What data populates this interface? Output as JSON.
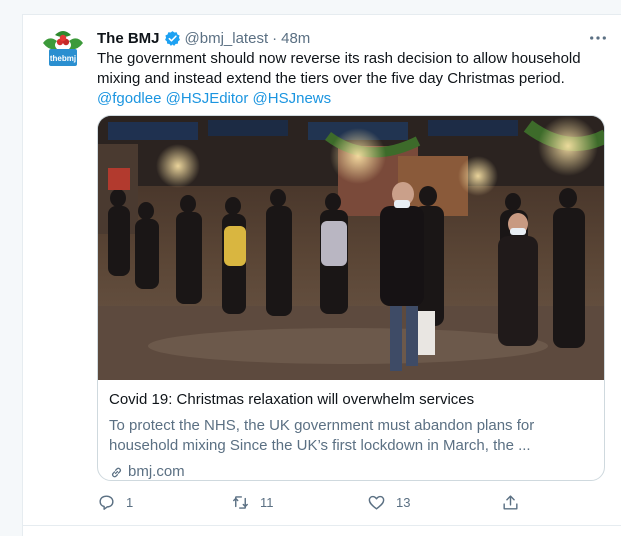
{
  "tweet": {
    "author": {
      "name": "The BMJ",
      "handle": "@bmj_latest",
      "avatar_text": "thebmj",
      "verified": true
    },
    "separator": "·",
    "time": "48m",
    "text": "The government should now reverse its rash decision to allow household mixing and instead extend the tiers over the five day Christmas period.",
    "mentions": [
      "@fgodlee",
      "@HSJEditor",
      "@HSJnews"
    ],
    "card": {
      "title": "Covid 19: Christmas relaxation will overwhelm services",
      "description": "To protect the NHS, the UK government must abandon plans for household mixing Since the UK’s first lockdown in March, the ...",
      "domain": "bmj.com",
      "image_alt": "Crowd of shoppers wearing face masks on a festive London street"
    },
    "actions": {
      "replies": "1",
      "retweets": "11",
      "likes": "13"
    }
  },
  "colors": {
    "link": "#1b95e0",
    "muted": "#5b7083",
    "verified": "#1da1f2",
    "border": "#cfd9de",
    "avatar_brand": "#2a8fd0"
  },
  "icons": [
    "more-icon",
    "verified-icon",
    "reply-icon",
    "retweet-icon",
    "like-icon",
    "share-icon",
    "link-icon"
  ]
}
